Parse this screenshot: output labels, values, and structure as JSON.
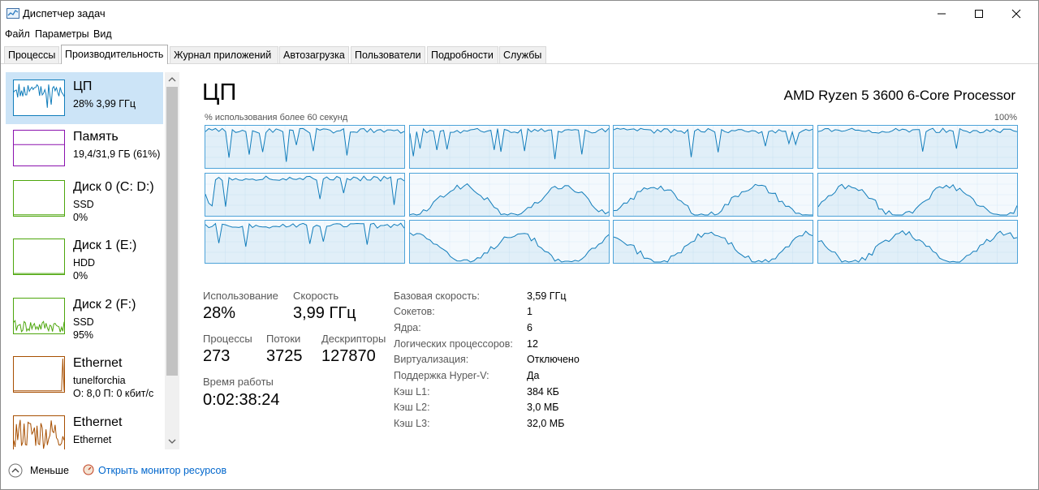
{
  "window": {
    "title": "Диспетчер задач"
  },
  "menu": [
    "Файл",
    "Параметры",
    "Вид"
  ],
  "tabs": [
    "Процессы",
    "Производительность",
    "Журнал приложений",
    "Автозагрузка",
    "Пользователи",
    "Подробности",
    "Службы"
  ],
  "active_tab": 1,
  "sidebar": {
    "items": [
      {
        "name": "ЦП",
        "sub1": "28%  3,99 ГГц",
        "sub2": "",
        "sub3": "",
        "color": "#117dbb"
      },
      {
        "name": "Память",
        "sub1": "19,4/31,9 ГБ (61%)",
        "sub2": "",
        "sub3": "",
        "color": "#8b12ae"
      },
      {
        "name": "Диск 0 (C: D:)",
        "sub1": "SSD",
        "sub2": "0%",
        "sub3": "",
        "color": "#4da60c"
      },
      {
        "name": "Диск 1 (E:)",
        "sub1": "HDD",
        "sub2": "0%",
        "sub3": "",
        "color": "#4da60c"
      },
      {
        "name": "Диск 2 (F:)",
        "sub1": "SSD",
        "sub2": "95%",
        "sub3": "",
        "color": "#4da60c"
      },
      {
        "name": "Ethernet",
        "sub1": "tunelforchia",
        "sub2": "О: 8,0  П: 0 кбит/с",
        "sub3": "",
        "color": "#a74f01"
      },
      {
        "name": "Ethernet",
        "sub1": "Ethernet",
        "sub2": "",
        "sub3": "",
        "color": "#a74f01"
      }
    ]
  },
  "main": {
    "title": "ЦП",
    "model": "AMD Ryzen 5 3600 6-Core Processor",
    "graph_label": "% использования более 60 секунд",
    "graph_max": "100%",
    "core_count": 12,
    "graph_color": "#117dbb"
  },
  "stats": {
    "usage_label": "Использование",
    "usage": "28%",
    "speed_label": "Скорость",
    "speed": "3,99 ГГц",
    "processes_label": "Процессы",
    "processes": "273",
    "threads_label": "Потоки",
    "threads": "3725",
    "handles_label": "Дескрипторы",
    "handles": "127870",
    "uptime_label": "Время работы",
    "uptime": "0:02:38:24"
  },
  "info": [
    {
      "label": "Базовая скорость:",
      "value": "3,59 ГГц"
    },
    {
      "label": "Сокетов:",
      "value": "1"
    },
    {
      "label": "Ядра:",
      "value": "6"
    },
    {
      "label": "Логических процессоров:",
      "value": "12"
    },
    {
      "label": "Виртуализация:",
      "value": "Отключено"
    },
    {
      "label": "Поддержка Hyper-V:",
      "value": "Да"
    },
    {
      "label": "Кэш L1:",
      "value": "384 КБ"
    },
    {
      "label": "Кэш L2:",
      "value": "3,0 МБ"
    },
    {
      "label": "Кэш L3:",
      "value": "32,0 МБ"
    }
  ],
  "footer": {
    "fewer": "Меньше",
    "monitor": "Открыть монитор ресурсов"
  }
}
